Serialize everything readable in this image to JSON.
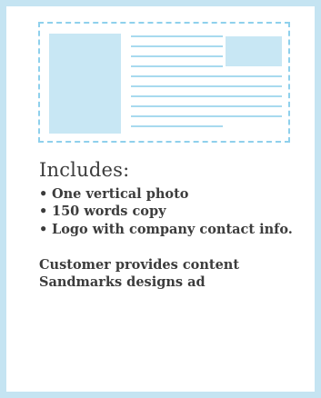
{
  "details": {
    "heading": "Includes:",
    "items": [
      "One vertical photo",
      "150 words copy",
      "Logo with company contact info."
    ],
    "note_lines": [
      "Customer provides content",
      "Sandmarks designs ad"
    ]
  },
  "colors": {
    "frame": "#c5e4f2",
    "dashed_border": "#8fd0ec",
    "placeholder_fill": "#c8e7f4",
    "text_lines": "#a8daef",
    "text": "#3c3c3c"
  },
  "icons": {
    "bullet": "•"
  }
}
